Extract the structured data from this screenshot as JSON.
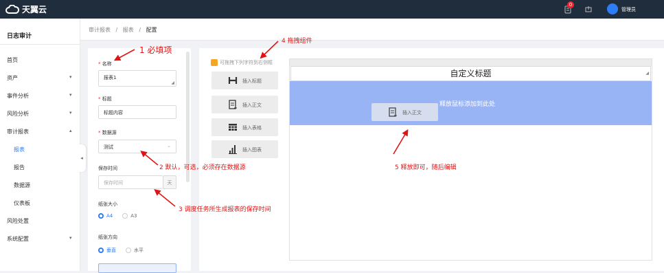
{
  "topbar": {
    "app_name": "天翼云",
    "badge_count": "0",
    "user_name": "管理员"
  },
  "sidebar": {
    "title": "日志审计",
    "items": [
      {
        "label": "首页"
      },
      {
        "label": "资产"
      },
      {
        "label": "事件分析"
      },
      {
        "label": "风险分析"
      },
      {
        "label": "审计报表"
      },
      {
        "label": "报表"
      },
      {
        "label": "报告"
      },
      {
        "label": "数据源"
      },
      {
        "label": "仪表板"
      },
      {
        "label": "风险处置"
      },
      {
        "label": "系统配置"
      }
    ]
  },
  "breadcrumb": {
    "item1": "审计报表",
    "item2": "报表",
    "item3": "配置",
    "sep": "/"
  },
  "form": {
    "name_label": "名称",
    "name_value": "报表1",
    "title_label": "标题",
    "title_value": "标题内容",
    "datasource_label": "数据源",
    "datasource_value": "测试",
    "retention_label": "保存时间",
    "retention_placeholder": "保存时间",
    "retention_unit": "天",
    "paper_label": "纸张大小",
    "paper_a4": "A4",
    "paper_a3": "A3",
    "orientation_label": "纸张方向",
    "orient_vertical": "垂直",
    "orient_horizontal": "水平"
  },
  "palette": {
    "hint": "可拖拽下列字符到右侧框",
    "items": [
      {
        "label": "插入标题",
        "icon": "heading-icon"
      },
      {
        "label": "插入正文",
        "icon": "text-doc-icon"
      },
      {
        "label": "插入表格",
        "icon": "table-icon"
      },
      {
        "label": "插入图表",
        "icon": "bar-chart-icon"
      }
    ]
  },
  "design": {
    "title": "自定义标题",
    "drop_text": "释放鼠标添加到此处",
    "drag_label": "插入正文"
  },
  "annotations": {
    "a1": "1 必填项",
    "a2": "2 默认，可选，必须存在数据源",
    "a3": "3 调度任务所生成报表的保存时间",
    "a4": "4 拖拽组件",
    "a5": "5 释放即可，随后编辑"
  },
  "colors": {
    "accent": "#2f7df6",
    "topbar": "#1f2d3d",
    "annotation": "#e01414",
    "drop_zone": "#98b4f5"
  }
}
